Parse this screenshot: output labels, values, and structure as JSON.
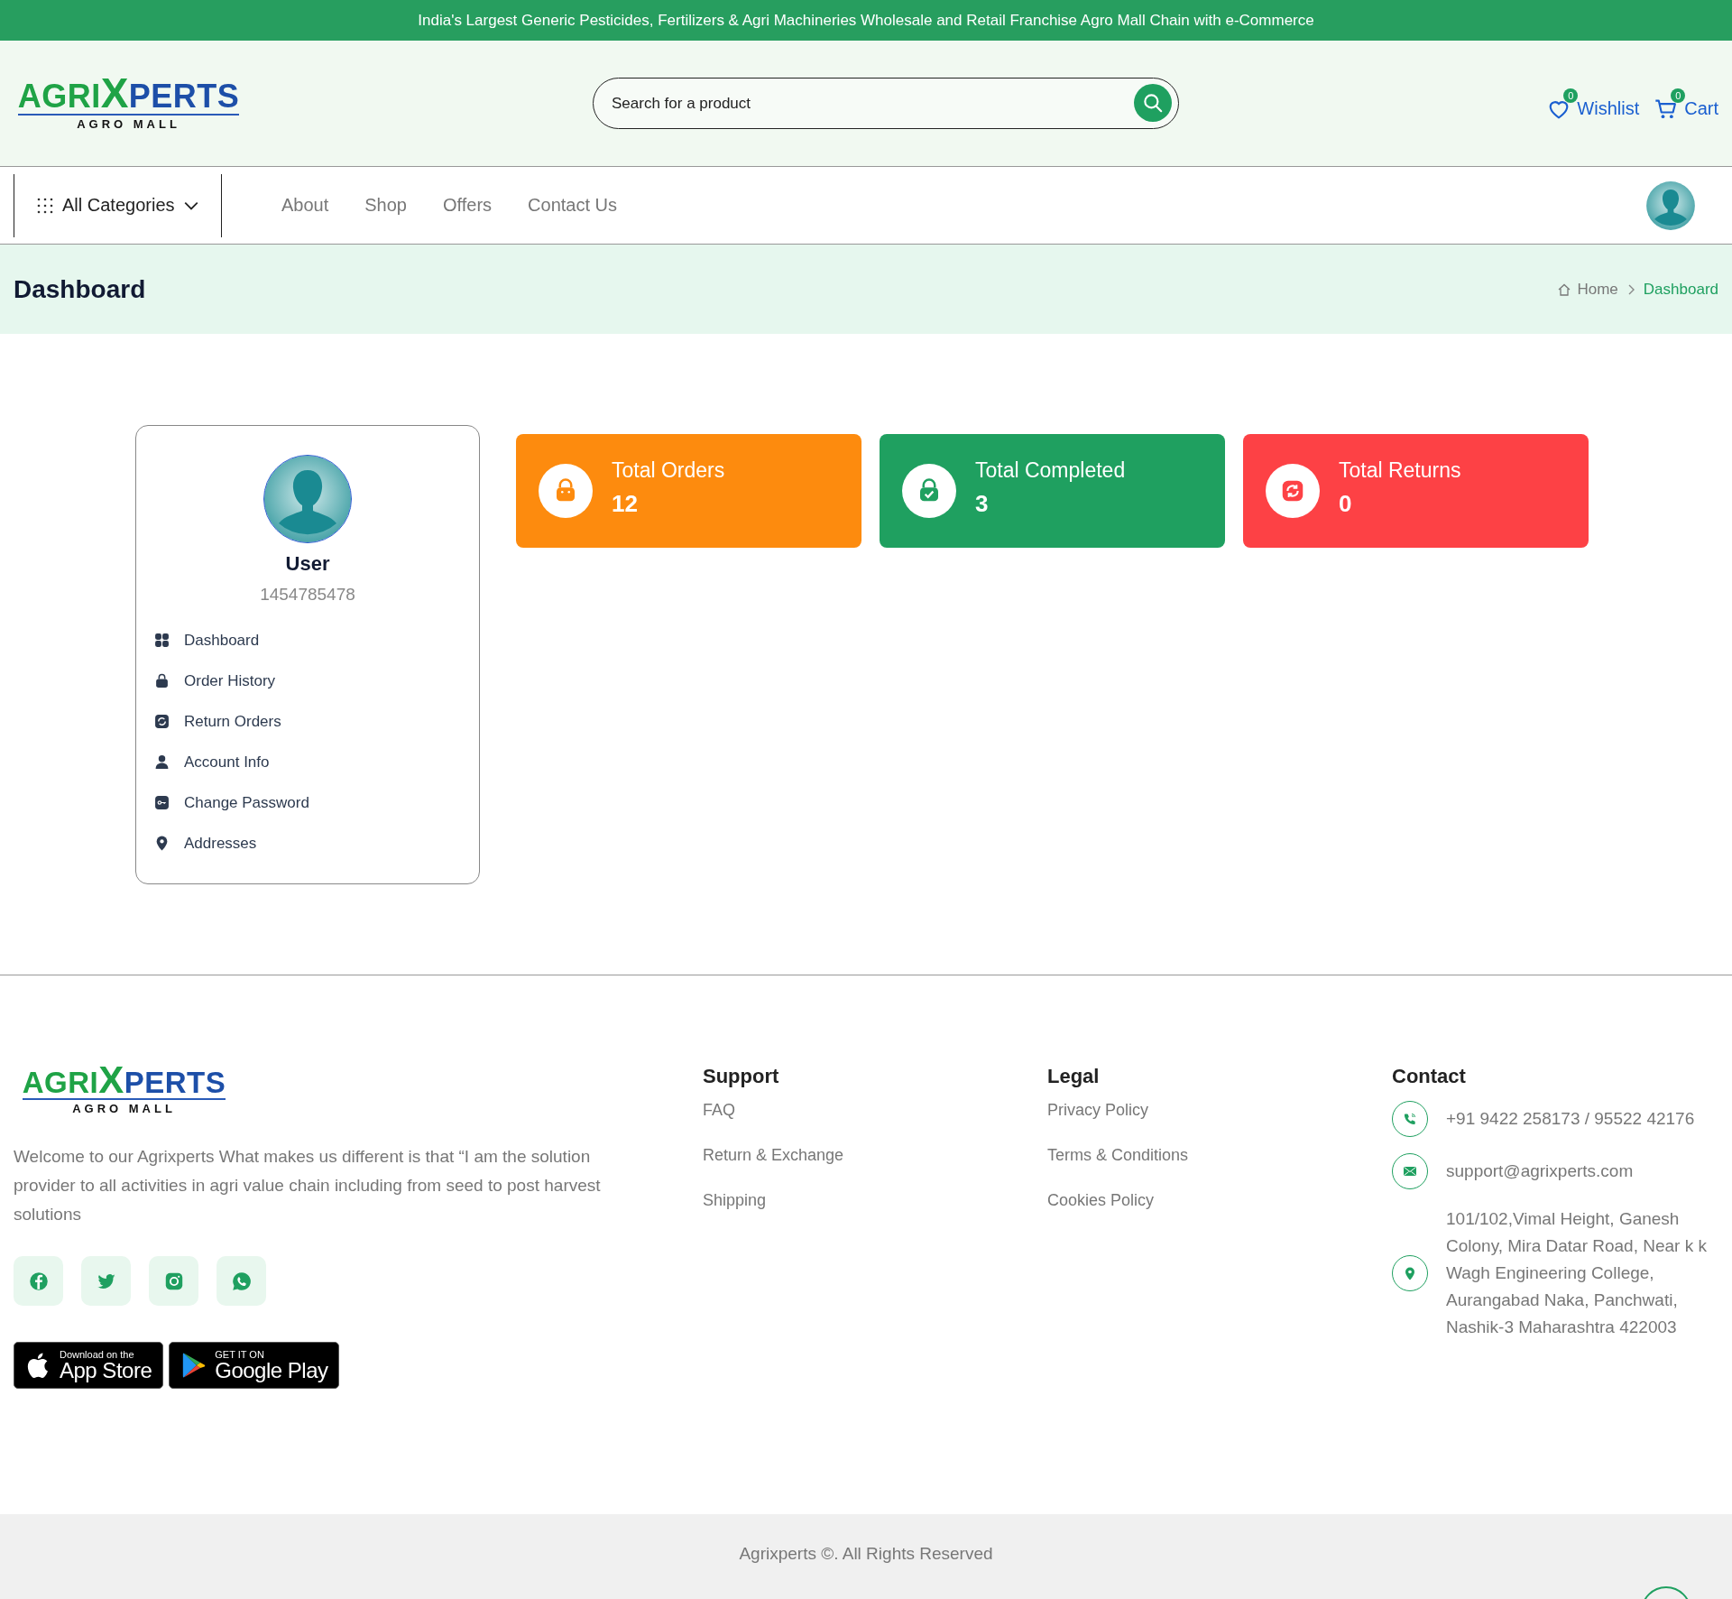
{
  "announcement": "India's Largest Generic Pesticides, Fertilizers & Agri Machineries Wholesale and Retail Franchise Agro Mall Chain with e-Commerce",
  "logo": {
    "part_1": "AGRI",
    "part_2": "X",
    "part_3": "PERTS",
    "tagline": "AGRO MALL"
  },
  "search": {
    "placeholder": "Search for a product"
  },
  "header_links": [
    {
      "label": "Wishlist",
      "count": "0"
    },
    {
      "label": "Cart",
      "count": "0"
    }
  ],
  "categories_button": {
    "label": "All Categories"
  },
  "nav": [
    {
      "label": "About"
    },
    {
      "label": "Shop"
    },
    {
      "label": "Offers"
    },
    {
      "label": "Contact Us"
    }
  ],
  "page_title": "Dashboard",
  "breadcrumb": [
    {
      "label": "Home",
      "selected": false
    },
    {
      "label": "Dashboard",
      "selected": true
    }
  ],
  "profile": {
    "name": "User",
    "phone": "1454785478"
  },
  "sidebar": {
    "items": [
      {
        "label": "Dashboard"
      },
      {
        "label": "Order History"
      },
      {
        "label": "Return Orders"
      },
      {
        "label": "Account Info"
      },
      {
        "label": "Change Password"
      },
      {
        "label": "Addresses"
      }
    ]
  },
  "stats": [
    {
      "title": "Total Orders",
      "value": "12",
      "color": "#fd8b0e"
    },
    {
      "title": "Total Completed",
      "value": "3",
      "color": "#1fa060"
    },
    {
      "title": "Total Returns",
      "value": "0",
      "color": "#fd4145"
    }
  ],
  "footer": {
    "logo": {
      "part_1": "AGRI",
      "part_2": "X",
      "part_3": "PERTS",
      "tagline": "AGRO MALL"
    },
    "about": "Welcome to our Agrixperts What makes us different is that “I am the solution provider to all activities in agri value chain including from seed to post harvest solutions",
    "app_badges": [
      {
        "small": "Download on the",
        "big": "App Store"
      },
      {
        "small": "GET IT ON",
        "big": "Google Play"
      }
    ],
    "columns": [
      {
        "heading": "Support",
        "links": [
          "FAQ",
          "Return & Exchange",
          "Shipping"
        ]
      },
      {
        "heading": "Legal",
        "links": [
          "Privacy Policy",
          "Terms & Conditions",
          "Cookies Policy"
        ]
      }
    ],
    "contact": {
      "heading": "Contact",
      "items": [
        "+91 9422 258173 / 95522 42176",
        "support@agrixperts.com",
        "101/102,Vimal Height, Ganesh Colony, Mira Datar Road, Near k k Wagh Engineering College, Aurangabad Naka, Panchwati, Nashik-3 Maharashtra 422003"
      ]
    }
  },
  "copyright": "Agrixperts ©. All Rights Reserved"
}
